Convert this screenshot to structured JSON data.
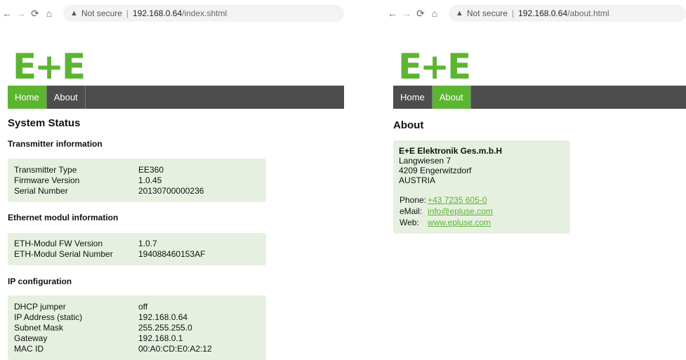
{
  "left": {
    "browser": {
      "warning": "Not secure",
      "separator": "|",
      "host": "192.168.0.64",
      "path": "/index.shtml"
    },
    "logo": "E+E",
    "menu": [
      {
        "label": "Home",
        "active": true
      },
      {
        "label": "About",
        "active": false
      }
    ],
    "page_title": "System Status",
    "sections": [
      {
        "title": "Transmitter information",
        "rows": [
          [
            "Transmitter Type",
            "EE360"
          ],
          [
            "Firmware Version",
            "1.0.45"
          ],
          [
            "Serial Number",
            "20130700000236"
          ]
        ]
      },
      {
        "title": "Ethernet modul information",
        "rows": [
          [
            "ETH-Modul FW Version",
            "1.0.7"
          ],
          [
            "ETH-Modul Serial Number",
            "194088460153AF"
          ]
        ]
      },
      {
        "title": "IP configuration",
        "rows": [
          [
            "DHCP jumper",
            "off"
          ],
          [
            "IP Address (static)",
            "192.168.0.64"
          ],
          [
            "Subnet Mask",
            "255.255.255.0"
          ],
          [
            "Gateway",
            "192.168.0.1"
          ],
          [
            "MAC ID",
            "00:A0:CD:E0:A2:12"
          ]
        ]
      }
    ]
  },
  "right": {
    "browser": {
      "warning": "Not secure",
      "separator": "|",
      "host": "192.168.0.64",
      "path": "/about.html"
    },
    "logo": "E+E",
    "menu": [
      {
        "label": "Home",
        "active": false
      },
      {
        "label": "About",
        "active": true
      }
    ],
    "page_title": "About",
    "company": "E+E Elektronik Ges.m.b.H",
    "address": [
      "Langwiesen 7",
      "4209 Engerwitzdorf",
      "AUSTRIA"
    ],
    "phone_label": "Phone:",
    "phone": "+43 7235 605-0",
    "email_label": "eMail:",
    "email": "info@epluse.com",
    "web_label": "Web:",
    "web": "www.epluse.com"
  },
  "colors": {
    "brand_green": "#5cb531",
    "menu_dark": "#4d4d4d",
    "panel_bg": "#e6f0e0"
  },
  "icons": [
    "back-arrow-icon",
    "forward-arrow-icon",
    "reload-icon",
    "home-icon",
    "warning-icon"
  ]
}
